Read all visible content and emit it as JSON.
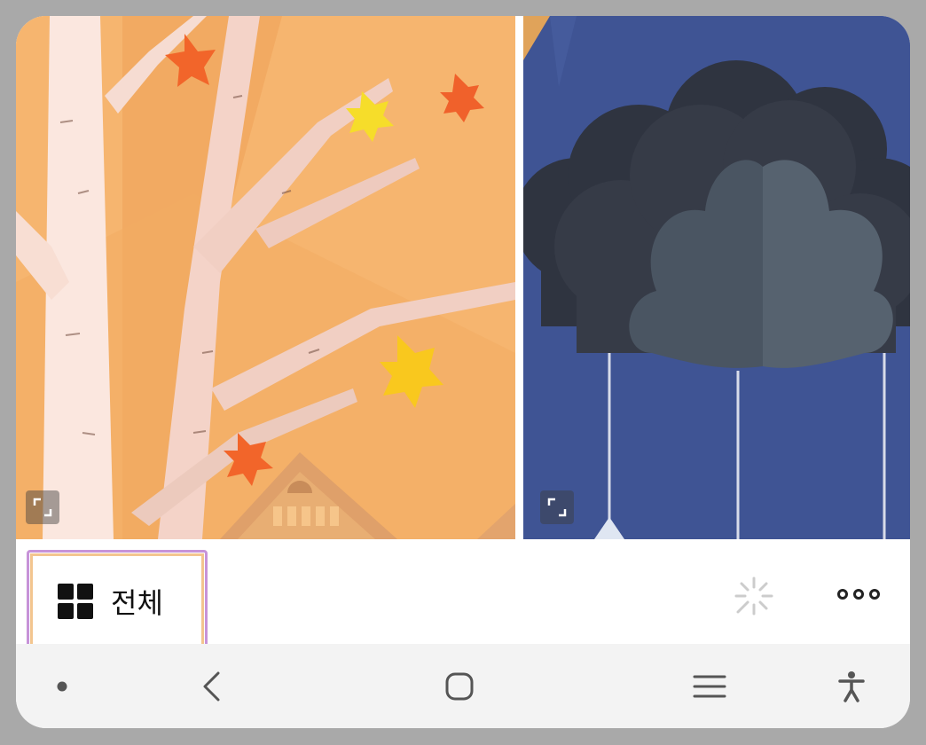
{
  "gallery": {
    "items": [
      {
        "name": "autumn-tree-wallpaper",
        "expand_icon": "expand-icon"
      },
      {
        "name": "rain-cloud-wallpaper",
        "expand_icon": "expand-icon"
      }
    ]
  },
  "toolbar": {
    "filter_label": "전체",
    "filter_icon": "grid-icon",
    "sparkle_icon": "sparkle-icon",
    "more_icon": "more-options-icon",
    "accent_border": "#c793d8",
    "accent_outline": "#f3c58f"
  },
  "navbar": {
    "icons": [
      "dot-icon",
      "back-icon",
      "home-icon",
      "recents-icon",
      "accessibility-icon"
    ]
  }
}
